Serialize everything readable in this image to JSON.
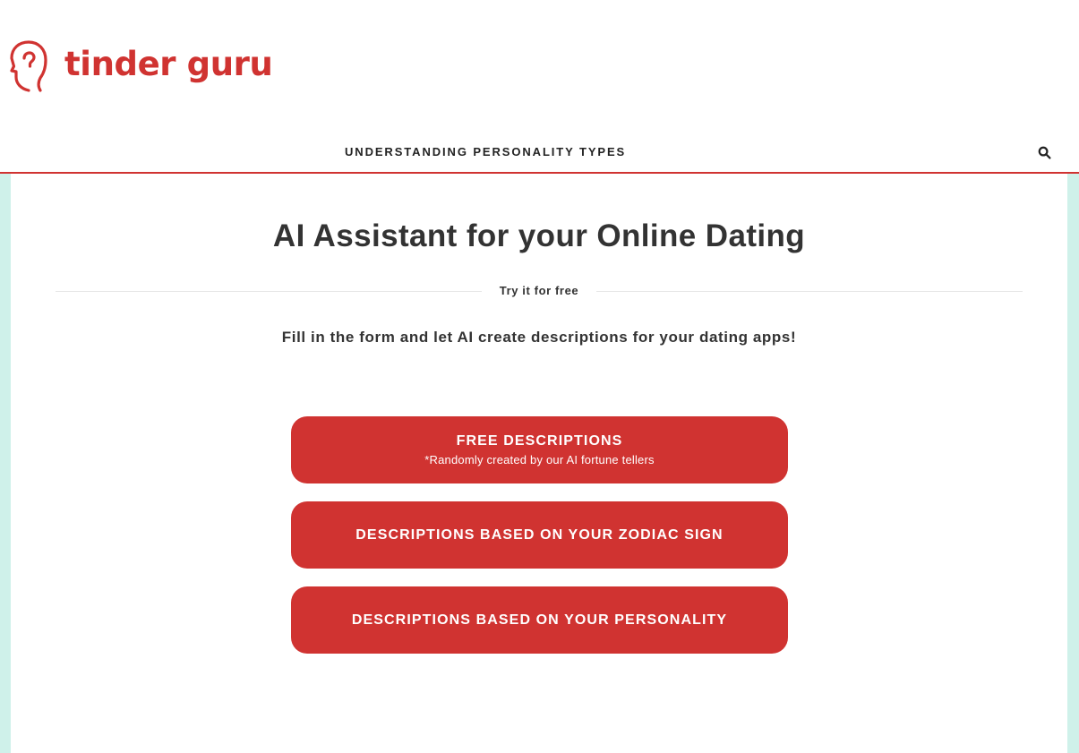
{
  "brand": {
    "name": "tinder guru",
    "color": "#d03331",
    "logo_icon": "head-profile-icon"
  },
  "nav": {
    "items": [
      {
        "label": "UNDERSTANDING PERSONALITY TYPES"
      }
    ],
    "search_icon": "search-icon"
  },
  "hero": {
    "title": "AI Assistant for your Online Dating",
    "divider_label": "Try it for free",
    "intro": "Fill in the form and let AI create descriptions for your dating apps!"
  },
  "options": [
    {
      "label": "FREE DESCRIPTIONS",
      "sublabel": "*Randomly created by our AI fortune tellers"
    },
    {
      "label": "DESCRIPTIONS BASED ON YOUR ZODIAC SIGN"
    },
    {
      "label": "DESCRIPTIONS BASED ON YOUR PERSONALITY"
    }
  ],
  "colors": {
    "accent": "#d03331",
    "page_background": "#cff1ea",
    "text": "#333333"
  }
}
